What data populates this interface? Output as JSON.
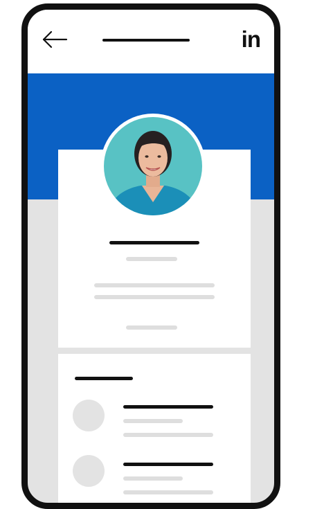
{
  "app": {
    "brand_logo": "in",
    "brand_color": "#111111",
    "accent_color": "#0b61c4"
  },
  "header": {
    "back_icon": "arrow-left-icon",
    "title_placeholder": "title-line"
  },
  "profile": {
    "avatar_icon": "profile-photo",
    "banner_color": "#0b61c4"
  },
  "list": {
    "item_count": 2
  }
}
